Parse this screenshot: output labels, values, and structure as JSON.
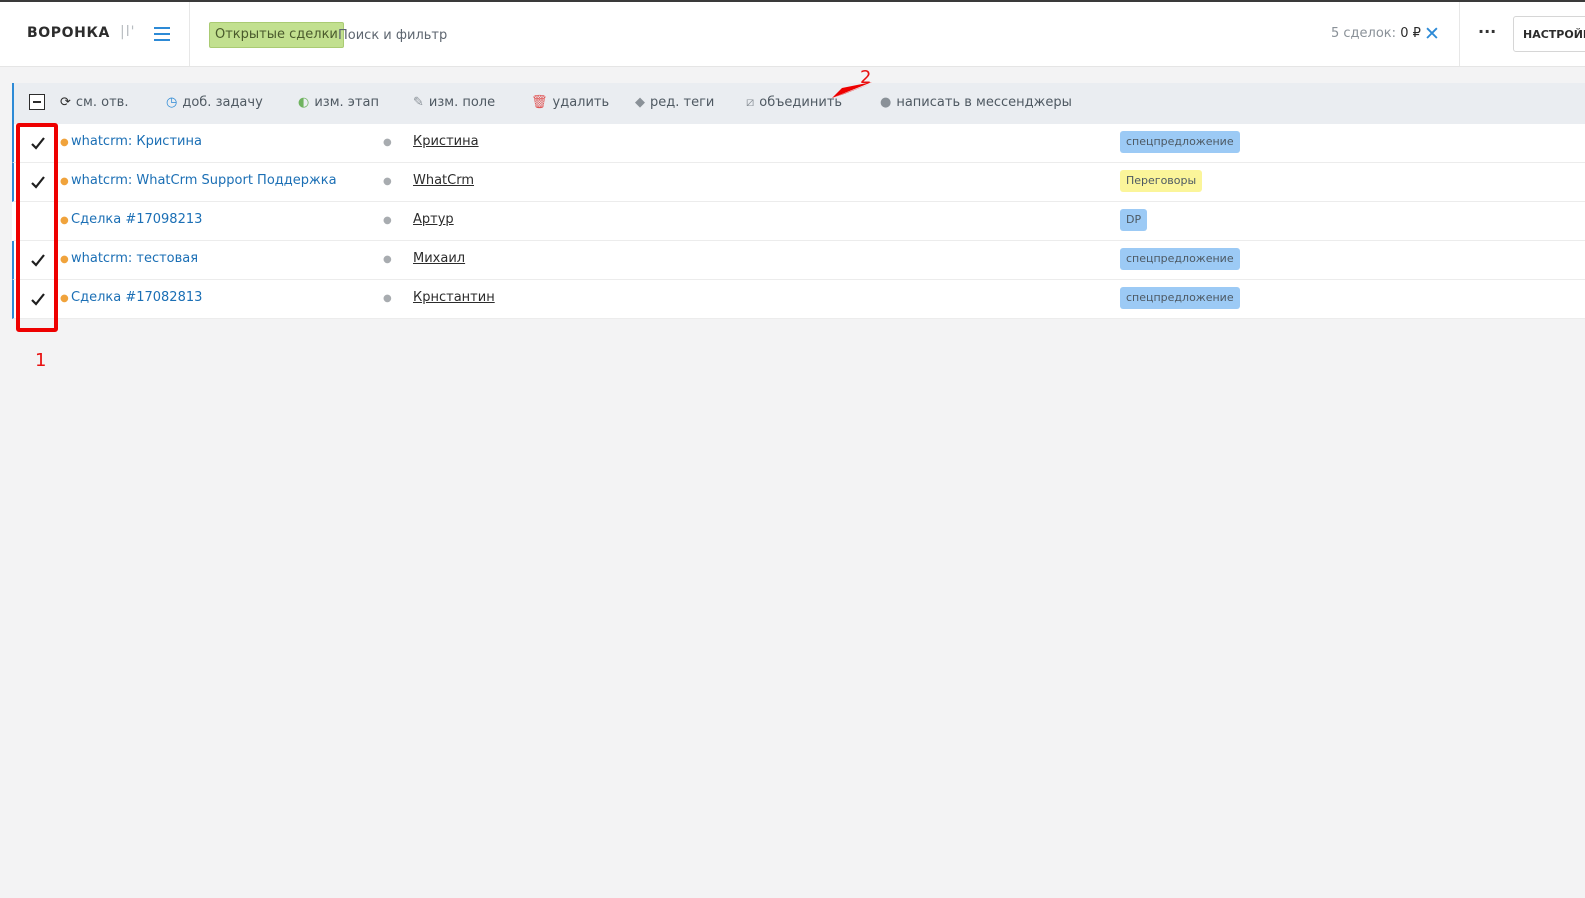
{
  "header": {
    "title": "ВОРОНКА",
    "view_icon_glyph": "|l'",
    "filter_chip": "Открытые сделки",
    "search_placeholder": "Поиск и фильтр",
    "deals_count_label": "5 сделок:",
    "deals_sum": "0 ₽",
    "close_glyph": "✕",
    "more_glyph": "···",
    "settings_label": "НАСТРОЙКИ"
  },
  "toolbar": {
    "actions": [
      {
        "label": "см. отв.",
        "icon": "refresh-icon",
        "glyph": "⟳",
        "color": "#2c2c2c"
      },
      {
        "label": "доб. задачу",
        "icon": "clock-icon",
        "glyph": "◷",
        "color": "#2d8ad6"
      },
      {
        "label": "изм. этап",
        "icon": "stage-circle-icon",
        "glyph": "◐",
        "color": "#6fb35f"
      },
      {
        "label": "изм. поле",
        "icon": "pencil-icon",
        "glyph": "✎",
        "color": "#8a9198"
      },
      {
        "label": "удалить",
        "icon": "trash-icon",
        "glyph": "🗑",
        "color": "#e05555"
      },
      {
        "label": "ред. теги",
        "icon": "tag-icon",
        "glyph": "◆",
        "color": "#8a9198"
      },
      {
        "label": "объединить",
        "icon": "merge-icon",
        "glyph": "⧄",
        "color": "#8a9198"
      },
      {
        "label": "написать в мессенджеры",
        "icon": "chat-bubble-icon",
        "glyph": "●",
        "color": "#8a9198"
      }
    ]
  },
  "rows": [
    {
      "deal": "whatcrm: Кристина",
      "contact": "Кристина",
      "tag": "спецпредложение",
      "tag_color": "#9ccaf5",
      "checked": true
    },
    {
      "deal": "whatcrm: WhatCrm Support Поддержка",
      "contact": "WhatCrm",
      "tag": "Переговоры",
      "tag_color": "#fbf59a",
      "checked": true
    },
    {
      "deal": "Сделка #17098213",
      "contact": "Артур",
      "tag": "DP",
      "tag_color": "#9ccaf5",
      "checked": false
    },
    {
      "deal": "whatcrm: тестовая",
      "contact": "Михаил",
      "tag": "спецпредложение",
      "tag_color": "#9ccaf5",
      "checked": true
    },
    {
      "deal": "Сделка #17082813",
      "contact": "Крнстантин",
      "tag": "спецпредложение",
      "tag_color": "#9ccaf5",
      "checked": true
    }
  ],
  "annotations": {
    "label_1": "1",
    "label_2": "2",
    "color": "#e81010"
  }
}
